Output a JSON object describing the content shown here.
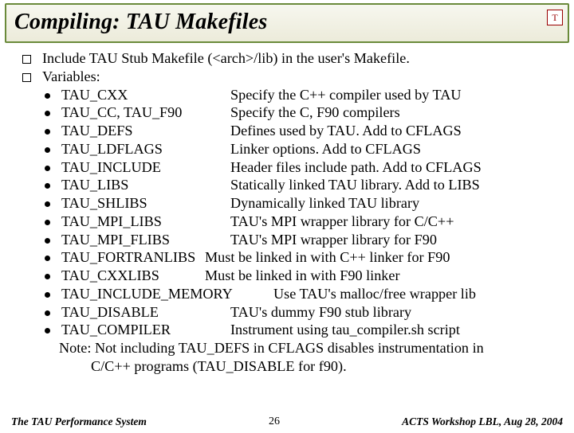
{
  "title": "Compiling: TAU Makefiles",
  "badge": "T",
  "bullets": {
    "include": "Include TAU Stub Makefile (<arch>/lib) in the user's Makefile.",
    "varsLabel": "Variables:"
  },
  "vars": [
    {
      "name": "TAU_CXX",
      "desc": "Specify the C++ compiler used by TAU",
      "nameW": 212
    },
    {
      "name": "TAU_CC, TAU_F90",
      "desc": "Specify the C, F90 compilers",
      "nameW": 212
    },
    {
      "name": "TAU_DEFS",
      "desc": "Defines used by TAU. Add to CFLAGS",
      "nameW": 212
    },
    {
      "name": "TAU_LDFLAGS",
      "desc": "Linker options. Add to CFLAGS",
      "nameW": 212
    },
    {
      "name": "TAU_INCLUDE",
      "desc": "Header files include path. Add to CFLAGS",
      "nameW": 212
    },
    {
      "name": "TAU_LIBS",
      "desc": "Statically linked TAU library. Add to LIBS",
      "nameW": 212
    },
    {
      "name": "TAU_SHLIBS",
      "desc": "Dynamically linked TAU library",
      "nameW": 212
    },
    {
      "name": "TAU_MPI_LIBS",
      "desc": "TAU's MPI wrapper library for C/C++",
      "nameW": 212
    },
    {
      "name": "TAU_MPI_FLIBS",
      "desc": "TAU's MPI wrapper library for F90",
      "nameW": 212
    },
    {
      "name": "TAU_FORTRANLIBS",
      "desc": "Must be linked in with C++ linker for F90",
      "nameW": 180
    },
    {
      "name": "TAU_CXXLIBS",
      "desc": "Must be linked in with F90 linker",
      "nameW": 180
    },
    {
      "name": "TAU_INCLUDE_MEMORY",
      "desc": "Use TAU's malloc/free wrapper lib",
      "nameW": 266
    },
    {
      "name": "TAU_DISABLE",
      "desc": "TAU's dummy F90 stub library",
      "nameW": 212
    },
    {
      "name": "TAU_COMPILER",
      "desc": "Instrument using tau_compiler.sh script",
      "nameW": 212
    }
  ],
  "note1": "Note: Not including TAU_DEFS in CFLAGS disables instrumentation in",
  "note2": "C/C++ programs (TAU_DISABLE for f90).",
  "footer": {
    "left": "The TAU Performance System",
    "center": "26",
    "right": "ACTS Workshop LBL, Aug 28, 2004"
  }
}
